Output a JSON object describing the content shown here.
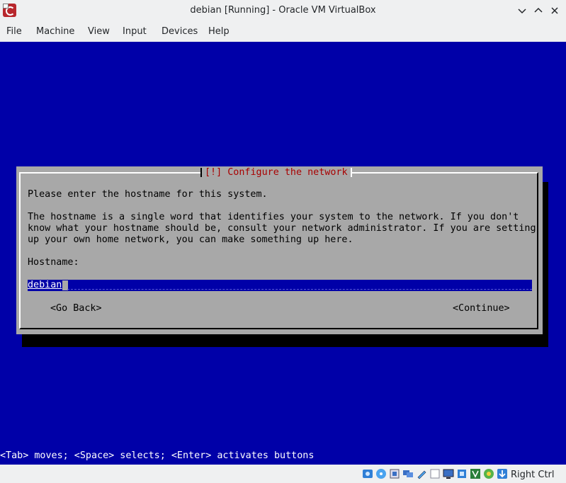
{
  "window": {
    "title": "debian [Running] - Oracle VM VirtualBox"
  },
  "menubar": {
    "items": [
      "File",
      "Machine",
      "View",
      "Input",
      "Devices",
      "Help"
    ]
  },
  "vm": {
    "dialog": {
      "title": "[!] Configure the network",
      "prompt": "Please enter the hostname for this system.",
      "description": [
        "The hostname is a single word that identifies your system to the network. If you don't",
        "know what your hostname should be, consult your network administrator. If you are setting",
        "up your own home network, you can make something up here."
      ],
      "hostname_label": "Hostname:",
      "hostname_value": "debian",
      "go_back": "<Go Back>",
      "continue": "<Continue>"
    },
    "help_line": "<Tab> moves; <Space> selects; <Enter> activates buttons"
  },
  "statusbar": {
    "icons": [
      "hard-disk-icon",
      "optical-drive-icon",
      "audio-icon",
      "network-icon",
      "usb-icon",
      "shared-folders-icon",
      "display-icon",
      "recording-icon",
      "virtualization-icon",
      "mouse-integration-icon",
      "keyboard-capture-icon"
    ],
    "host_key": "Right Ctrl"
  },
  "colors": {
    "vm_background": "#0000a8",
    "dialog_background": "#a8a8a8",
    "dialog_title": "#a80000",
    "window_chrome": "#eff0f1"
  }
}
